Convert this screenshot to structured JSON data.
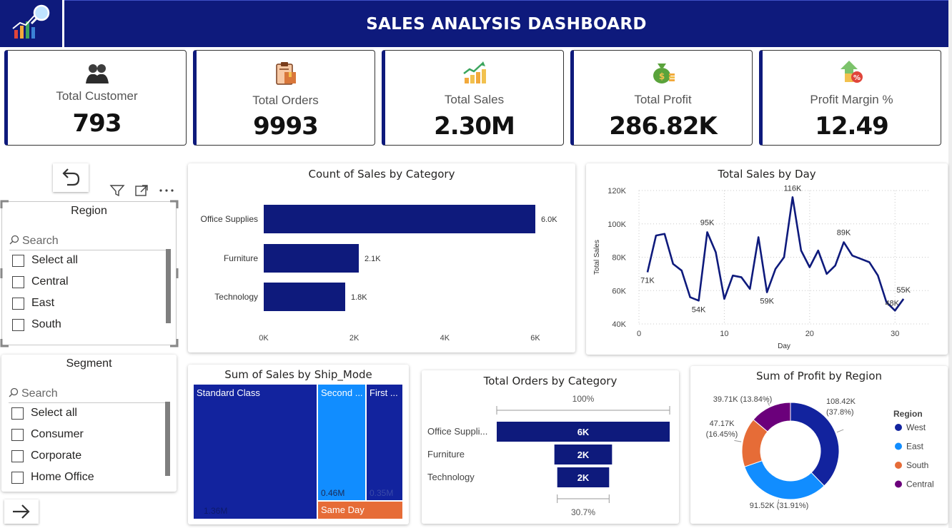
{
  "header": {
    "title": "SALES ANALYSIS DASHBOARD"
  },
  "kpis": [
    {
      "label": "Total Customer",
      "value": "793",
      "icon": "customers-icon"
    },
    {
      "label": "Total Orders",
      "value": "9993",
      "icon": "orders-clipboard-icon"
    },
    {
      "label": "Total Sales",
      "value": "2.30M",
      "icon": "sales-growth-icon"
    },
    {
      "label": "Total Profit",
      "value": "286.82K",
      "icon": "money-bag-icon"
    },
    {
      "label": "Profit Margin %",
      "value": "12.49",
      "icon": "profit-margin-icon"
    }
  ],
  "region_slicer": {
    "title": "Region",
    "search_placeholder": "Search",
    "options": [
      "Select all",
      "Central",
      "East",
      "South"
    ]
  },
  "segment_slicer": {
    "title": "Segment",
    "search_placeholder": "Search",
    "options": [
      "Select all",
      "Consumer",
      "Corporate",
      "Home Office"
    ]
  },
  "colors": {
    "navy": "#0e1a7c",
    "blue": "#118dff",
    "orange": "#e66c37",
    "purple": "#6b007b",
    "bar": "#12239e"
  },
  "chart_data": [
    {
      "id": "count_by_category",
      "type": "bar",
      "orientation": "horizontal",
      "title": "Count of Sales by Category",
      "categories": [
        "Office Supplies",
        "Furniture",
        "Technology"
      ],
      "values": [
        6000,
        2100,
        1800
      ],
      "data_labels": [
        "6.0K",
        "2.1K",
        "1.8K"
      ],
      "xlim": [
        0,
        6000
      ],
      "x_ticks": [
        0,
        2000,
        4000,
        6000
      ],
      "x_tick_labels": [
        "0K",
        "2K",
        "4K",
        "6K"
      ]
    },
    {
      "id": "sales_by_day",
      "type": "line",
      "title": "Total Sales by Day",
      "xlabel": "Day",
      "ylabel": "Total Sales",
      "x": [
        1,
        2,
        3,
        4,
        5,
        6,
        7,
        8,
        9,
        10,
        11,
        12,
        13,
        14,
        15,
        16,
        17,
        18,
        19,
        20,
        21,
        22,
        23,
        24,
        25,
        26,
        27,
        28,
        29,
        30,
        31
      ],
      "values": [
        71000,
        93000,
        94000,
        76000,
        72000,
        56000,
        54000,
        95000,
        83000,
        55000,
        69000,
        68000,
        61000,
        92000,
        59000,
        73000,
        80000,
        116000,
        84000,
        74000,
        84000,
        70000,
        75000,
        89000,
        81000,
        79000,
        77000,
        69000,
        53000,
        48000,
        55000
      ],
      "annotations": [
        {
          "x": 1,
          "label": "71K"
        },
        {
          "x": 7,
          "label": "54K"
        },
        {
          "x": 8,
          "label": "95K"
        },
        {
          "x": 15,
          "label": "59K"
        },
        {
          "x": 18,
          "label": "116K"
        },
        {
          "x": 24,
          "label": "89K"
        },
        {
          "x": 30,
          "label": "48K"
        },
        {
          "x": 31,
          "label": "55K"
        }
      ],
      "ylim": [
        40000,
        120000
      ],
      "y_ticks": [
        40000,
        60000,
        80000,
        100000,
        120000
      ],
      "y_tick_labels": [
        "40K",
        "60K",
        "80K",
        "100K",
        "120K"
      ],
      "xlim": [
        0,
        34
      ],
      "x_ticks": [
        0,
        10,
        20,
        30
      ],
      "x_tick_labels": [
        "0",
        "10",
        "20",
        "30"
      ],
      "grid": true
    },
    {
      "id": "sales_by_ship_mode",
      "type": "treemap",
      "title": "Sum of Sales by Ship_Mode",
      "categories": [
        "Standard Class",
        "Second ...",
        "First ...",
        "Same Day"
      ],
      "values": [
        1360000,
        460000,
        350000,
        130000
      ],
      "data_labels": [
        "1.36M",
        "0.46M",
        "0.35M",
        ""
      ]
    },
    {
      "id": "orders_by_category",
      "type": "funnel",
      "title": "Total Orders by Category",
      "categories": [
        "Office Suppli...",
        "Furniture",
        "Technology"
      ],
      "values": [
        6000,
        2000,
        2000
      ],
      "data_labels": [
        "6K",
        "2K",
        "2K"
      ],
      "top_percent": "100%",
      "bottom_percent": "30.7%"
    },
    {
      "id": "profit_by_region",
      "type": "pie",
      "donut": true,
      "title": "Sum of Profit by Region",
      "legend_title": "Region",
      "legend_position": "right",
      "categories": [
        "West",
        "East",
        "South",
        "Central"
      ],
      "values": [
        108420,
        91520,
        47170,
        39710
      ],
      "data_labels": [
        "108.42K (37.8%)",
        "91.52K (31.91%)",
        "47.17K (16.45%)",
        "39.71K (13.84%)"
      ]
    }
  ]
}
